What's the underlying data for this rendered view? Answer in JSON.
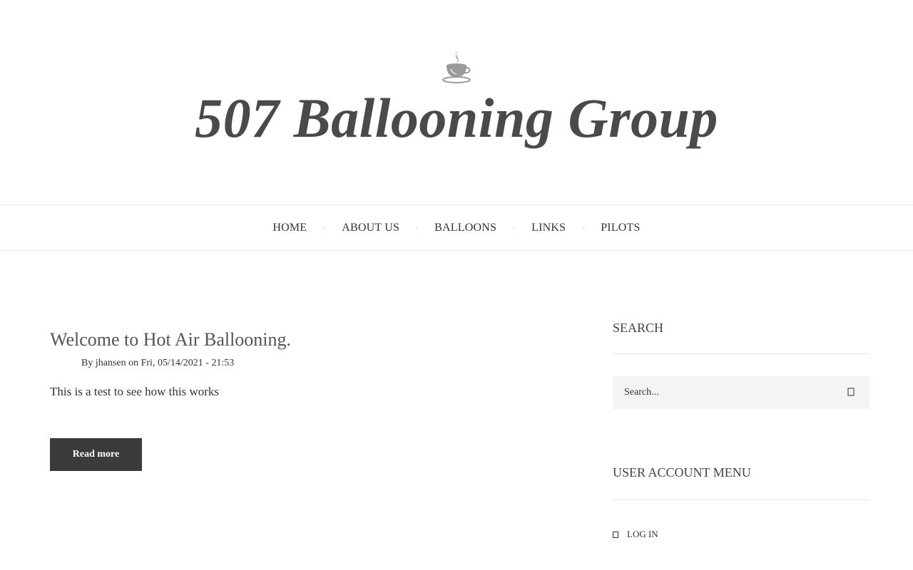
{
  "header": {
    "logo_icon": "coffee-cup-icon",
    "site_title": "507 Ballooning Group"
  },
  "nav": {
    "items": [
      {
        "label": "HOME"
      },
      {
        "label": "ABOUT US"
      },
      {
        "label": "BALLOONS"
      },
      {
        "label": "LINKS"
      },
      {
        "label": "PILOTS"
      }
    ],
    "separator": "·"
  },
  "article": {
    "title": "Welcome to Hot Air Ballooning.",
    "meta": "By jhansen on Fri, 05/14/2021 - 21:53",
    "body": "This is a test to see how this works",
    "read_more_label": "Read more"
  },
  "sidebar": {
    "search": {
      "title": "SEARCH",
      "placeholder": "Search...",
      "submit_icon": "search-icon"
    },
    "user_account_menu": {
      "title": "USER ACCOUNT MENU",
      "items": [
        {
          "label": "LOG IN",
          "icon": "user-icon"
        }
      ]
    }
  },
  "colors": {
    "title": "#4a4a4a",
    "button_bg": "#3b3b3b",
    "search_bg": "#f4f4f4",
    "divider": "#e6e6e6"
  }
}
